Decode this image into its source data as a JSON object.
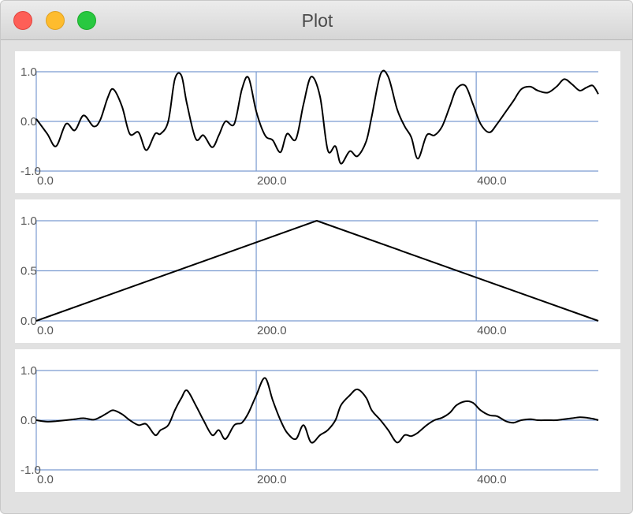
{
  "window": {
    "title": "Plot",
    "buttons": [
      "close",
      "minimize",
      "zoom"
    ]
  },
  "style": {
    "grid_color": "#7a9bd0",
    "line_color": "#000000"
  },
  "chart_data": [
    {
      "type": "line",
      "title": "",
      "xlabel": "",
      "ylabel": "",
      "xlim": [
        0,
        511
      ],
      "ylim": [
        -1.0,
        1.0
      ],
      "x_ticks": [
        0,
        200,
        400
      ],
      "x_tick_labels": [
        "0.0",
        "200.0",
        "400.0"
      ],
      "y_ticks": [
        1.0,
        0.0,
        -1.0
      ],
      "y_tick_labels": [
        "1.0",
        "0.0",
        "-1.0"
      ],
      "grid": true,
      "series": [
        {
          "x": [
            0,
            10,
            18,
            27,
            35,
            43,
            52,
            58,
            65,
            70,
            78,
            85,
            93,
            100,
            108,
            113,
            120,
            126,
            132,
            137,
            145,
            152,
            160,
            166,
            172,
            180,
            187,
            193,
            200,
            208,
            215,
            222,
            228,
            236,
            243,
            250,
            258,
            265,
            272,
            277,
            285,
            292,
            300,
            305,
            313,
            320,
            328,
            335,
            341,
            347,
            355,
            362,
            369,
            376,
            382,
            390,
            397,
            404,
            412,
            419,
            427,
            434,
            441,
            449,
            456,
            465,
            473,
            480,
            487,
            494,
            500,
            506,
            511
          ],
          "y": [
            0.05,
            -0.25,
            -0.5,
            -0.05,
            -0.18,
            0.12,
            -0.1,
            0.02,
            0.48,
            0.65,
            0.3,
            -0.25,
            -0.22,
            -0.58,
            -0.25,
            -0.25,
            0.0,
            0.85,
            0.92,
            0.35,
            -0.35,
            -0.28,
            -0.52,
            -0.28,
            0.0,
            -0.05,
            0.65,
            0.88,
            0.2,
            -0.28,
            -0.38,
            -0.62,
            -0.25,
            -0.36,
            0.35,
            0.9,
            0.5,
            -0.58,
            -0.5,
            -0.85,
            -0.6,
            -0.7,
            -0.4,
            0.1,
            0.95,
            0.9,
            0.25,
            -0.1,
            -0.32,
            -0.75,
            -0.28,
            -0.28,
            -0.1,
            0.3,
            0.65,
            0.72,
            0.35,
            -0.05,
            -0.22,
            -0.05,
            0.2,
            0.42,
            0.65,
            0.7,
            0.62,
            0.58,
            0.7,
            0.85,
            0.75,
            0.62,
            0.68,
            0.72,
            0.55
          ]
        }
      ]
    },
    {
      "type": "line",
      "title": "",
      "xlabel": "",
      "ylabel": "",
      "xlim": [
        0,
        511
      ],
      "ylim": [
        0.0,
        1.0
      ],
      "x_ticks": [
        0,
        200,
        400
      ],
      "x_tick_labels": [
        "0.0",
        "200.0",
        "400.0"
      ],
      "y_ticks": [
        1.0,
        0.5,
        0.0
      ],
      "y_tick_labels": [
        "1.0",
        "0.5",
        "0.0"
      ],
      "grid": true,
      "series": [
        {
          "x": [
            0,
            255,
            511
          ],
          "y": [
            0.0,
            1.0,
            0.0
          ]
        }
      ]
    },
    {
      "type": "line",
      "title": "",
      "xlabel": "",
      "ylabel": "",
      "xlim": [
        0,
        511
      ],
      "ylim": [
        -1.0,
        1.0
      ],
      "x_ticks": [
        0,
        200,
        400
      ],
      "x_tick_labels": [
        "0.0",
        "200.0",
        "400.0"
      ],
      "y_ticks": [
        1.0,
        0.0,
        -1.0
      ],
      "y_tick_labels": [
        "1.0",
        "0.0",
        "-1.0"
      ],
      "grid": true,
      "series": [
        {
          "x": [
            0,
            10,
            18,
            27,
            35,
            43,
            52,
            58,
            65,
            70,
            78,
            85,
            93,
            100,
            108,
            113,
            120,
            126,
            132,
            137,
            145,
            152,
            160,
            166,
            172,
            180,
            187,
            193,
            200,
            208,
            215,
            222,
            228,
            236,
            243,
            250,
            258,
            265,
            272,
            277,
            285,
            292,
            300,
            305,
            313,
            320,
            328,
            335,
            341,
            347,
            355,
            362,
            369,
            376,
            382,
            390,
            397,
            404,
            412,
            419,
            427,
            434,
            441,
            449,
            456,
            465,
            473,
            480,
            487,
            494,
            500,
            506,
            511
          ],
          "y": [
            0.0,
            -0.03,
            -0.02,
            0.0,
            0.02,
            0.04,
            0.01,
            0.06,
            0.15,
            0.2,
            0.12,
            0.0,
            -0.1,
            -0.08,
            -0.3,
            -0.2,
            -0.1,
            0.2,
            0.45,
            0.6,
            0.3,
            0.0,
            -0.3,
            -0.2,
            -0.38,
            -0.1,
            -0.05,
            0.15,
            0.5,
            0.85,
            0.4,
            0.0,
            -0.25,
            -0.38,
            -0.1,
            -0.45,
            -0.3,
            -0.2,
            0.0,
            0.3,
            0.5,
            0.62,
            0.45,
            0.2,
            0.0,
            -0.2,
            -0.45,
            -0.3,
            -0.32,
            -0.25,
            -0.1,
            0.0,
            0.05,
            0.15,
            0.3,
            0.38,
            0.35,
            0.2,
            0.1,
            0.08,
            -0.02,
            -0.05,
            0.0,
            0.02,
            0.0,
            0.0,
            0.0,
            0.02,
            0.04,
            0.06,
            0.05,
            0.03,
            0.0
          ]
        }
      ]
    }
  ]
}
